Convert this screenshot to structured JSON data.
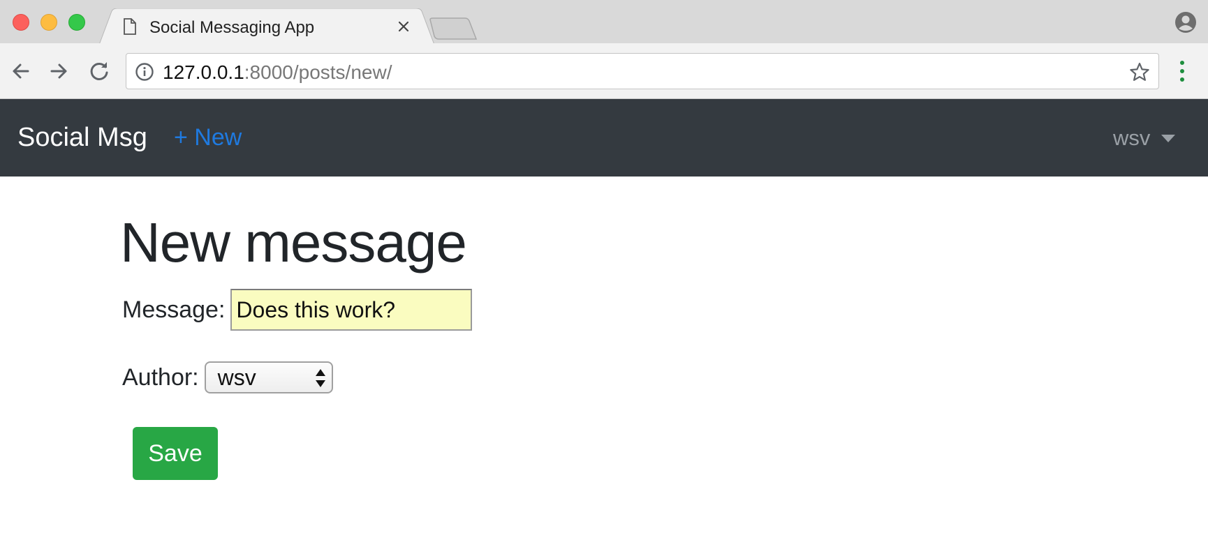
{
  "browser": {
    "tab": {
      "title": "Social Messaging App"
    },
    "address": {
      "host": "127.0.0.1",
      "rest": ":8000/posts/new/"
    },
    "icons": {
      "page": "page-icon",
      "close": "close-icon",
      "back": "back-arrow-icon",
      "forward": "forward-arrow-icon",
      "reload": "reload-icon",
      "info": "info-icon",
      "bookmark": "star-icon",
      "menu": "kebab-menu-icon",
      "profile": "profile-icon"
    },
    "colors": {
      "close": "#fc605c",
      "minimize": "#fdbc40",
      "zoom": "#34c84a",
      "menu_dots": "#1e8e3e"
    }
  },
  "navbar": {
    "brand": "Social Msg",
    "new_link": "+ New",
    "user": "wsv",
    "colors": {
      "background": "#343a40",
      "link": "#1f7ae0",
      "muted": "#9aa0a6"
    }
  },
  "form": {
    "title": "New message",
    "message_label": "Message:",
    "message_value": "Does this work?",
    "author_label": "Author:",
    "author_value": "wsv",
    "save_label": "Save",
    "colors": {
      "input_bg": "#fafcc0",
      "save_bg": "#28a745"
    }
  }
}
